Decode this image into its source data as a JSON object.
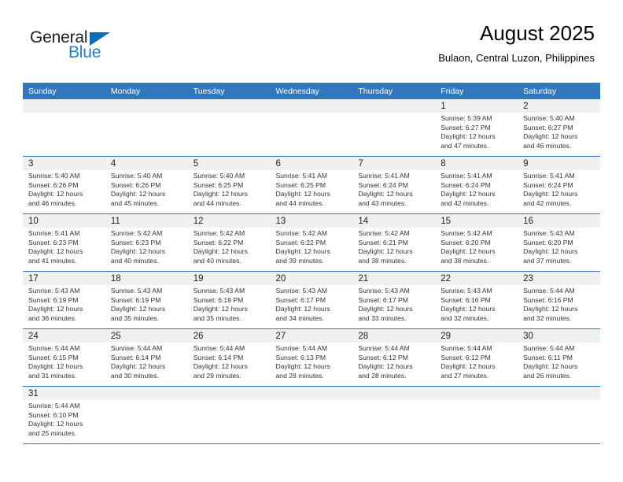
{
  "brand": {
    "name_part1": "General",
    "name_part2": "Blue",
    "accent_color": "#1b7fd4",
    "triangle_color": "#0b6bb5"
  },
  "header": {
    "title": "August 2025",
    "subtitle": "Bulaon, Central Luzon, Philippines",
    "header_bg_color": "#3277bc",
    "daynum_band_color": "#f0f0f0"
  },
  "weekdays": [
    "Sunday",
    "Monday",
    "Tuesday",
    "Wednesday",
    "Thursday",
    "Friday",
    "Saturday"
  ],
  "weeks": [
    [
      {
        "day": "",
        "sunrise": "",
        "sunset": "",
        "daylight_line1": "",
        "daylight_line2": ""
      },
      {
        "day": "",
        "sunrise": "",
        "sunset": "",
        "daylight_line1": "",
        "daylight_line2": ""
      },
      {
        "day": "",
        "sunrise": "",
        "sunset": "",
        "daylight_line1": "",
        "daylight_line2": ""
      },
      {
        "day": "",
        "sunrise": "",
        "sunset": "",
        "daylight_line1": "",
        "daylight_line2": ""
      },
      {
        "day": "",
        "sunrise": "",
        "sunset": "",
        "daylight_line1": "",
        "daylight_line2": ""
      },
      {
        "day": "1",
        "sunrise": "Sunrise: 5:39 AM",
        "sunset": "Sunset: 6:27 PM",
        "daylight_line1": "Daylight: 12 hours",
        "daylight_line2": "and 47 minutes."
      },
      {
        "day": "2",
        "sunrise": "Sunrise: 5:40 AM",
        "sunset": "Sunset: 6:27 PM",
        "daylight_line1": "Daylight: 12 hours",
        "daylight_line2": "and 46 minutes."
      }
    ],
    [
      {
        "day": "3",
        "sunrise": "Sunrise: 5:40 AM",
        "sunset": "Sunset: 6:26 PM",
        "daylight_line1": "Daylight: 12 hours",
        "daylight_line2": "and 46 minutes."
      },
      {
        "day": "4",
        "sunrise": "Sunrise: 5:40 AM",
        "sunset": "Sunset: 6:26 PM",
        "daylight_line1": "Daylight: 12 hours",
        "daylight_line2": "and 45 minutes."
      },
      {
        "day": "5",
        "sunrise": "Sunrise: 5:40 AM",
        "sunset": "Sunset: 6:25 PM",
        "daylight_line1": "Daylight: 12 hours",
        "daylight_line2": "and 44 minutes."
      },
      {
        "day": "6",
        "sunrise": "Sunrise: 5:41 AM",
        "sunset": "Sunset: 6:25 PM",
        "daylight_line1": "Daylight: 12 hours",
        "daylight_line2": "and 44 minutes."
      },
      {
        "day": "7",
        "sunrise": "Sunrise: 5:41 AM",
        "sunset": "Sunset: 6:24 PM",
        "daylight_line1": "Daylight: 12 hours",
        "daylight_line2": "and 43 minutes."
      },
      {
        "day": "8",
        "sunrise": "Sunrise: 5:41 AM",
        "sunset": "Sunset: 6:24 PM",
        "daylight_line1": "Daylight: 12 hours",
        "daylight_line2": "and 42 minutes."
      },
      {
        "day": "9",
        "sunrise": "Sunrise: 5:41 AM",
        "sunset": "Sunset: 6:24 PM",
        "daylight_line1": "Daylight: 12 hours",
        "daylight_line2": "and 42 minutes."
      }
    ],
    [
      {
        "day": "10",
        "sunrise": "Sunrise: 5:41 AM",
        "sunset": "Sunset: 6:23 PM",
        "daylight_line1": "Daylight: 12 hours",
        "daylight_line2": "and 41 minutes."
      },
      {
        "day": "11",
        "sunrise": "Sunrise: 5:42 AM",
        "sunset": "Sunset: 6:23 PM",
        "daylight_line1": "Daylight: 12 hours",
        "daylight_line2": "and 40 minutes."
      },
      {
        "day": "12",
        "sunrise": "Sunrise: 5:42 AM",
        "sunset": "Sunset: 6:22 PM",
        "daylight_line1": "Daylight: 12 hours",
        "daylight_line2": "and 40 minutes."
      },
      {
        "day": "13",
        "sunrise": "Sunrise: 5:42 AM",
        "sunset": "Sunset: 6:22 PM",
        "daylight_line1": "Daylight: 12 hours",
        "daylight_line2": "and 39 minutes."
      },
      {
        "day": "14",
        "sunrise": "Sunrise: 5:42 AM",
        "sunset": "Sunset: 6:21 PM",
        "daylight_line1": "Daylight: 12 hours",
        "daylight_line2": "and 38 minutes."
      },
      {
        "day": "15",
        "sunrise": "Sunrise: 5:42 AM",
        "sunset": "Sunset: 6:20 PM",
        "daylight_line1": "Daylight: 12 hours",
        "daylight_line2": "and 38 minutes."
      },
      {
        "day": "16",
        "sunrise": "Sunrise: 5:43 AM",
        "sunset": "Sunset: 6:20 PM",
        "daylight_line1": "Daylight: 12 hours",
        "daylight_line2": "and 37 minutes."
      }
    ],
    [
      {
        "day": "17",
        "sunrise": "Sunrise: 5:43 AM",
        "sunset": "Sunset: 6:19 PM",
        "daylight_line1": "Daylight: 12 hours",
        "daylight_line2": "and 36 minutes."
      },
      {
        "day": "18",
        "sunrise": "Sunrise: 5:43 AM",
        "sunset": "Sunset: 6:19 PM",
        "daylight_line1": "Daylight: 12 hours",
        "daylight_line2": "and 35 minutes."
      },
      {
        "day": "19",
        "sunrise": "Sunrise: 5:43 AM",
        "sunset": "Sunset: 6:18 PM",
        "daylight_line1": "Daylight: 12 hours",
        "daylight_line2": "and 35 minutes."
      },
      {
        "day": "20",
        "sunrise": "Sunrise: 5:43 AM",
        "sunset": "Sunset: 6:17 PM",
        "daylight_line1": "Daylight: 12 hours",
        "daylight_line2": "and 34 minutes."
      },
      {
        "day": "21",
        "sunrise": "Sunrise: 5:43 AM",
        "sunset": "Sunset: 6:17 PM",
        "daylight_line1": "Daylight: 12 hours",
        "daylight_line2": "and 33 minutes."
      },
      {
        "day": "22",
        "sunrise": "Sunrise: 5:43 AM",
        "sunset": "Sunset: 6:16 PM",
        "daylight_line1": "Daylight: 12 hours",
        "daylight_line2": "and 32 minutes."
      },
      {
        "day": "23",
        "sunrise": "Sunrise: 5:44 AM",
        "sunset": "Sunset: 6:16 PM",
        "daylight_line1": "Daylight: 12 hours",
        "daylight_line2": "and 32 minutes."
      }
    ],
    [
      {
        "day": "24",
        "sunrise": "Sunrise: 5:44 AM",
        "sunset": "Sunset: 6:15 PM",
        "daylight_line1": "Daylight: 12 hours",
        "daylight_line2": "and 31 minutes."
      },
      {
        "day": "25",
        "sunrise": "Sunrise: 5:44 AM",
        "sunset": "Sunset: 6:14 PM",
        "daylight_line1": "Daylight: 12 hours",
        "daylight_line2": "and 30 minutes."
      },
      {
        "day": "26",
        "sunrise": "Sunrise: 5:44 AM",
        "sunset": "Sunset: 6:14 PM",
        "daylight_line1": "Daylight: 12 hours",
        "daylight_line2": "and 29 minutes."
      },
      {
        "day": "27",
        "sunrise": "Sunrise: 5:44 AM",
        "sunset": "Sunset: 6:13 PM",
        "daylight_line1": "Daylight: 12 hours",
        "daylight_line2": "and 28 minutes."
      },
      {
        "day": "28",
        "sunrise": "Sunrise: 5:44 AM",
        "sunset": "Sunset: 6:12 PM",
        "daylight_line1": "Daylight: 12 hours",
        "daylight_line2": "and 28 minutes."
      },
      {
        "day": "29",
        "sunrise": "Sunrise: 5:44 AM",
        "sunset": "Sunset: 6:12 PM",
        "daylight_line1": "Daylight: 12 hours",
        "daylight_line2": "and 27 minutes."
      },
      {
        "day": "30",
        "sunrise": "Sunrise: 5:44 AM",
        "sunset": "Sunset: 6:11 PM",
        "daylight_line1": "Daylight: 12 hours",
        "daylight_line2": "and 26 minutes."
      }
    ],
    [
      {
        "day": "31",
        "sunrise": "Sunrise: 5:44 AM",
        "sunset": "Sunset: 6:10 PM",
        "daylight_line1": "Daylight: 12 hours",
        "daylight_line2": "and 25 minutes."
      },
      {
        "day": "",
        "sunrise": "",
        "sunset": "",
        "daylight_line1": "",
        "daylight_line2": ""
      },
      {
        "day": "",
        "sunrise": "",
        "sunset": "",
        "daylight_line1": "",
        "daylight_line2": ""
      },
      {
        "day": "",
        "sunrise": "",
        "sunset": "",
        "daylight_line1": "",
        "daylight_line2": ""
      },
      {
        "day": "",
        "sunrise": "",
        "sunset": "",
        "daylight_line1": "",
        "daylight_line2": ""
      },
      {
        "day": "",
        "sunrise": "",
        "sunset": "",
        "daylight_line1": "",
        "daylight_line2": ""
      },
      {
        "day": "",
        "sunrise": "",
        "sunset": "",
        "daylight_line1": "",
        "daylight_line2": ""
      }
    ]
  ]
}
